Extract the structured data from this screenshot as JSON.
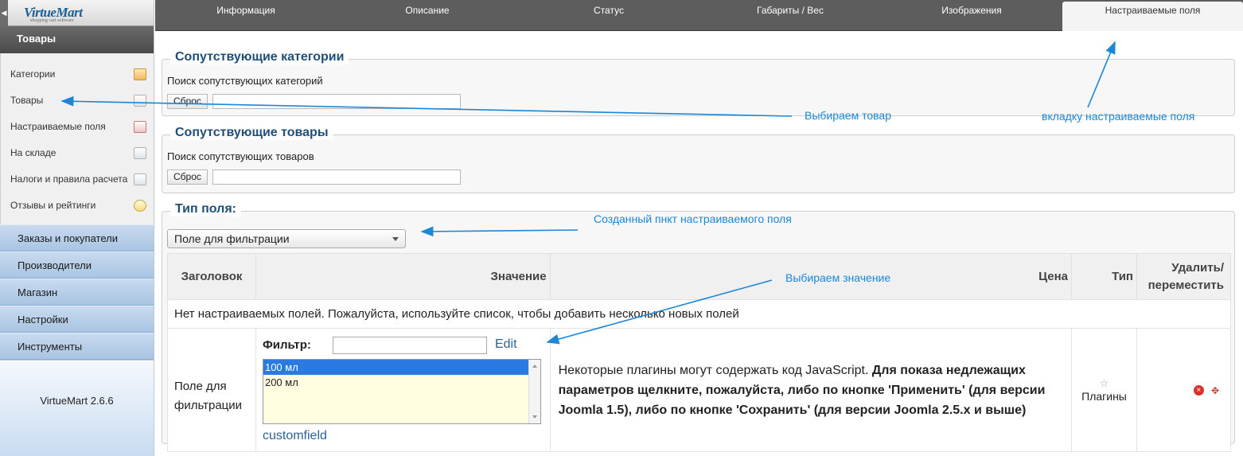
{
  "sidebar": {
    "logo": {
      "text": "VirtueMart",
      "tagline": "shopping cart software"
    },
    "section_title": "Товары",
    "items": [
      {
        "label": "Категории",
        "icon": "folder-icon"
      },
      {
        "label": "Товары",
        "icon": "product-icon"
      },
      {
        "label": "Настраиваемые поля",
        "icon": "customfields-icon"
      },
      {
        "label": "На складе",
        "icon": "stock-chart-icon"
      },
      {
        "label": "Налоги и правила расчета",
        "icon": "calculator-icon"
      },
      {
        "label": "Отзывы и рейтинги",
        "icon": "speech-bubble-icon"
      }
    ],
    "groups": [
      "Заказы и покупатели",
      "Производители",
      "Магазин",
      "Настройки",
      "Инструменты"
    ],
    "version": "VirtueMart 2.6.6"
  },
  "tabs": [
    "Информация",
    "Описание",
    "Статус",
    "Габариты / Вес",
    "Изображения",
    "Настраиваемые поля"
  ],
  "related_categories": {
    "legend": "Сопутствующие категории",
    "search_label": "Поиск сопутствующих категорий",
    "reset": "Сброс"
  },
  "related_products": {
    "legend": "Сопутствующие товары",
    "search_label": "Поиск сопутствующих товаров",
    "reset": "Сброс"
  },
  "field_type": {
    "legend": "Тип поля:",
    "selected": "Поле для фильтрации"
  },
  "table": {
    "headers": {
      "title": "Заголовок",
      "value": "Значение",
      "price": "Цена",
      "type": "Тип",
      "delete_line1": "Удалить/",
      "delete_line2": "переместить"
    },
    "empty_message": "Нет настраиваемых полей. Пожалуйста, используйте список, чтобы добавить несколько новых полей",
    "row": {
      "title_line1": "Поле для",
      "title_line2": "фильтрации",
      "filter_label": "Фильтр:",
      "edit": "Edit",
      "options": [
        "100 мл",
        "200 мл"
      ],
      "link": "customfield",
      "notice_plain": "Некоторые плагины могут содержать код JavaScript. ",
      "notice_bold": "Для показа недлежащих параметров щелкните, пожалуйста, либо по кнопке 'Применить' (для версии Joomla 1.5), либо по кнопке 'Сохранить' (для версии Joomla 2.5.x и выше)",
      "type": "Плагины"
    }
  },
  "annotations": {
    "choose_product": "Выбираем товар",
    "custom_tab": "вкладку настраиваемые поля",
    "created_item": "Созданный пнкт настраиваемого поля",
    "choose_value": "Выбираем значение"
  },
  "colors": {
    "annotation": "#1b87d6",
    "legend": "#1f4e79",
    "selected_option": "#2a7ae2"
  }
}
